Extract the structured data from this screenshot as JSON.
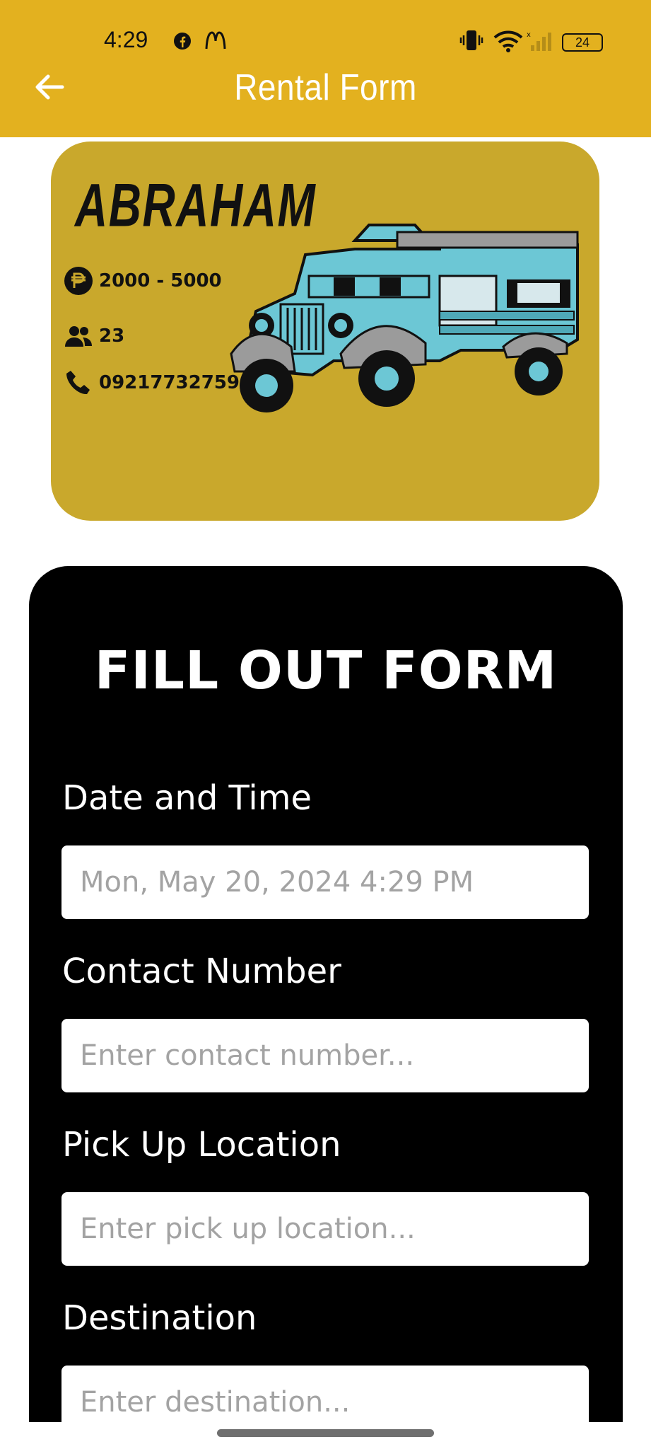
{
  "status_bar": {
    "time": "4:29",
    "battery": "24",
    "icons": [
      "facebook-icon",
      "mcdonalds-icon",
      "vibrate-icon",
      "wifi-icon",
      "signal-icon",
      "battery-icon"
    ]
  },
  "header": {
    "title": "Rental Form",
    "back_icon": "arrow-left-icon",
    "background_color": "#E3B11F"
  },
  "card": {
    "name": "ABRAHAM",
    "price": "2000 - 5000",
    "capacity": "23",
    "phone": "09217732759",
    "background_color": "#C9A82C",
    "icons": [
      "peso-icon",
      "group-icon",
      "phone-icon",
      "jeepney-illustration"
    ]
  },
  "form": {
    "heading": "FILL OUT FORM",
    "fields": [
      {
        "label": "Date and Time",
        "placeholder": "Mon, May 20, 2024 4:29 PM"
      },
      {
        "label": "Contact Number",
        "placeholder": "Enter contact number..."
      },
      {
        "label": "Pick Up Location",
        "placeholder": "Enter pick up location..."
      },
      {
        "label": "Destination",
        "placeholder": "Enter destination..."
      }
    ]
  }
}
